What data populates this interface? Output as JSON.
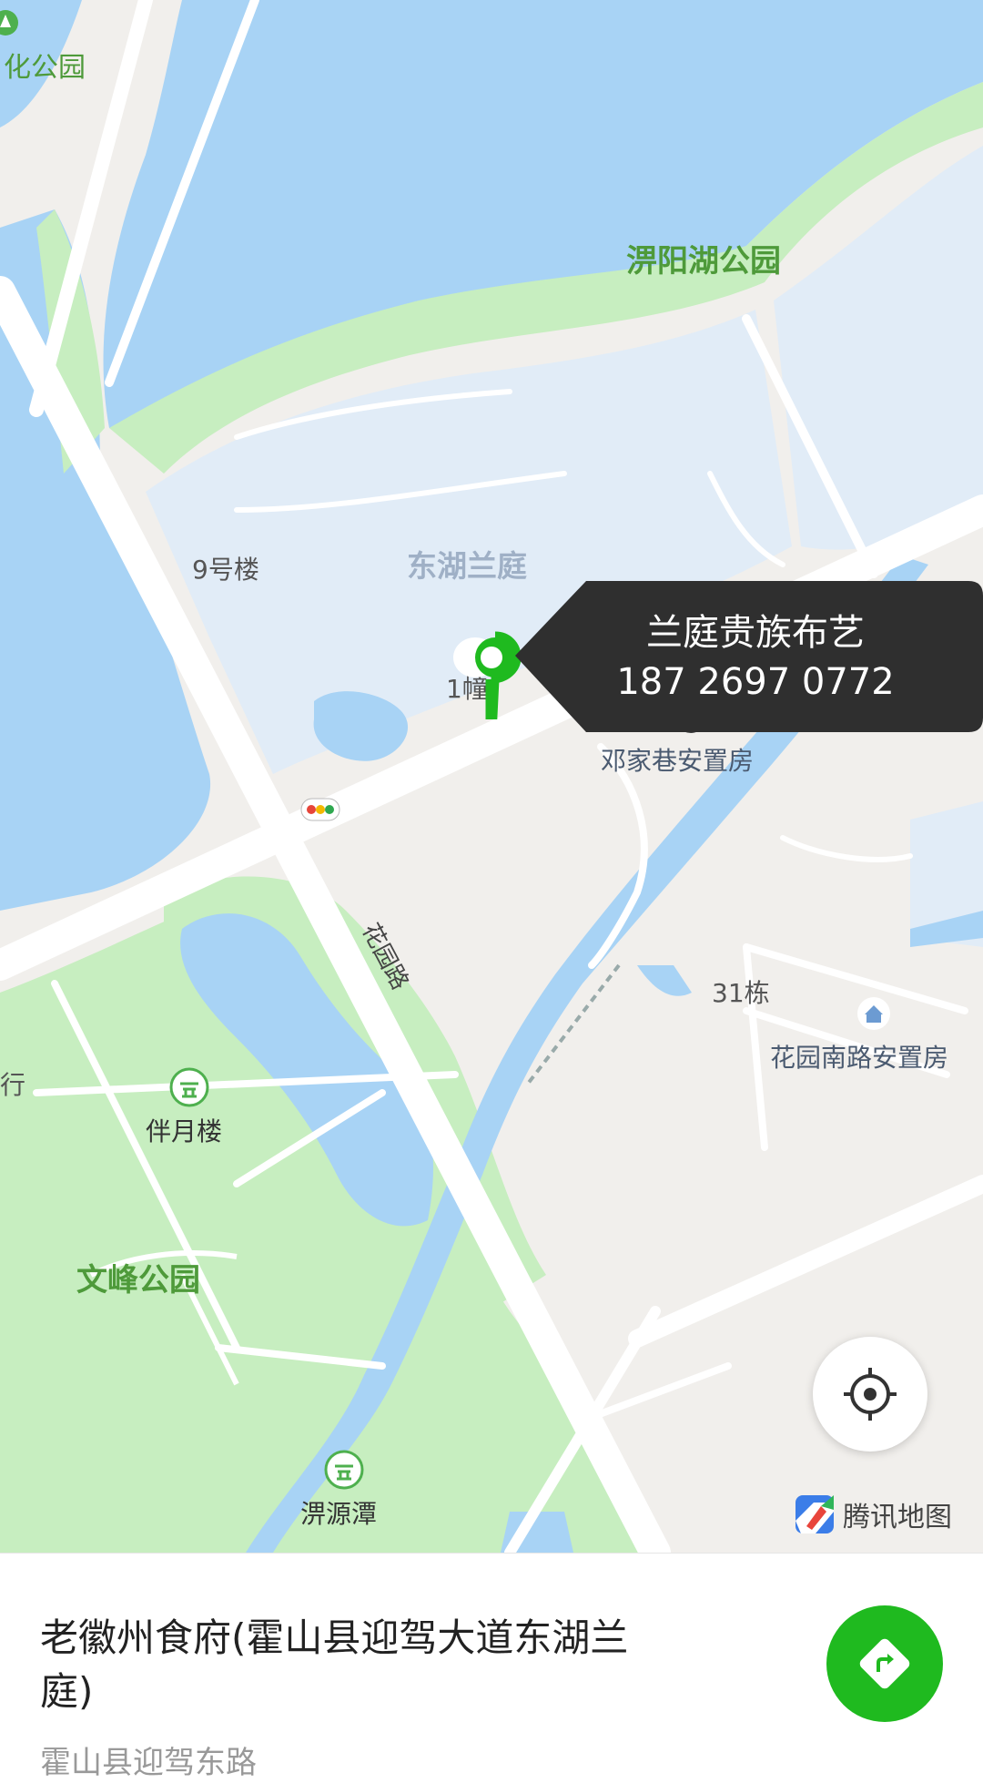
{
  "map": {
    "labels": {
      "park_top_left": "化公园",
      "lake_park": "淠阳湖公园",
      "estate": "东湖兰庭",
      "building_9": "9号楼",
      "building_1": "1幢",
      "resettlement_dengjia": "邓家巷安置房",
      "road_huayuan": "花园路",
      "building_31": "31栋",
      "resettlement_huayuan_south": "花园南路安置房",
      "left_edge": "行",
      "banyue": "伴月楼",
      "wenfeng_park": "文峰公园",
      "piyuan": "淠源潭"
    },
    "colors": {
      "water": "#a8d3f5",
      "green": "#c7eec0",
      "residential": "#e1ecf7",
      "ground": "#f1efec",
      "road": "#ffffff",
      "marker": "#1fba1f",
      "callout": "#2f2f2f"
    }
  },
  "callout": {
    "name": "兰庭贵族布艺",
    "phone": "187 2697 0772"
  },
  "controls": {
    "locate_icon": "locate-crosshair-icon",
    "brand_logo": "tencent-map-logo",
    "brand_text": "腾讯地图"
  },
  "place": {
    "name": "老徽州食府(霍山县迎驾大道东湖兰庭)",
    "address": "霍山县迎驾东路",
    "route_icon": "route-navigation-icon"
  }
}
